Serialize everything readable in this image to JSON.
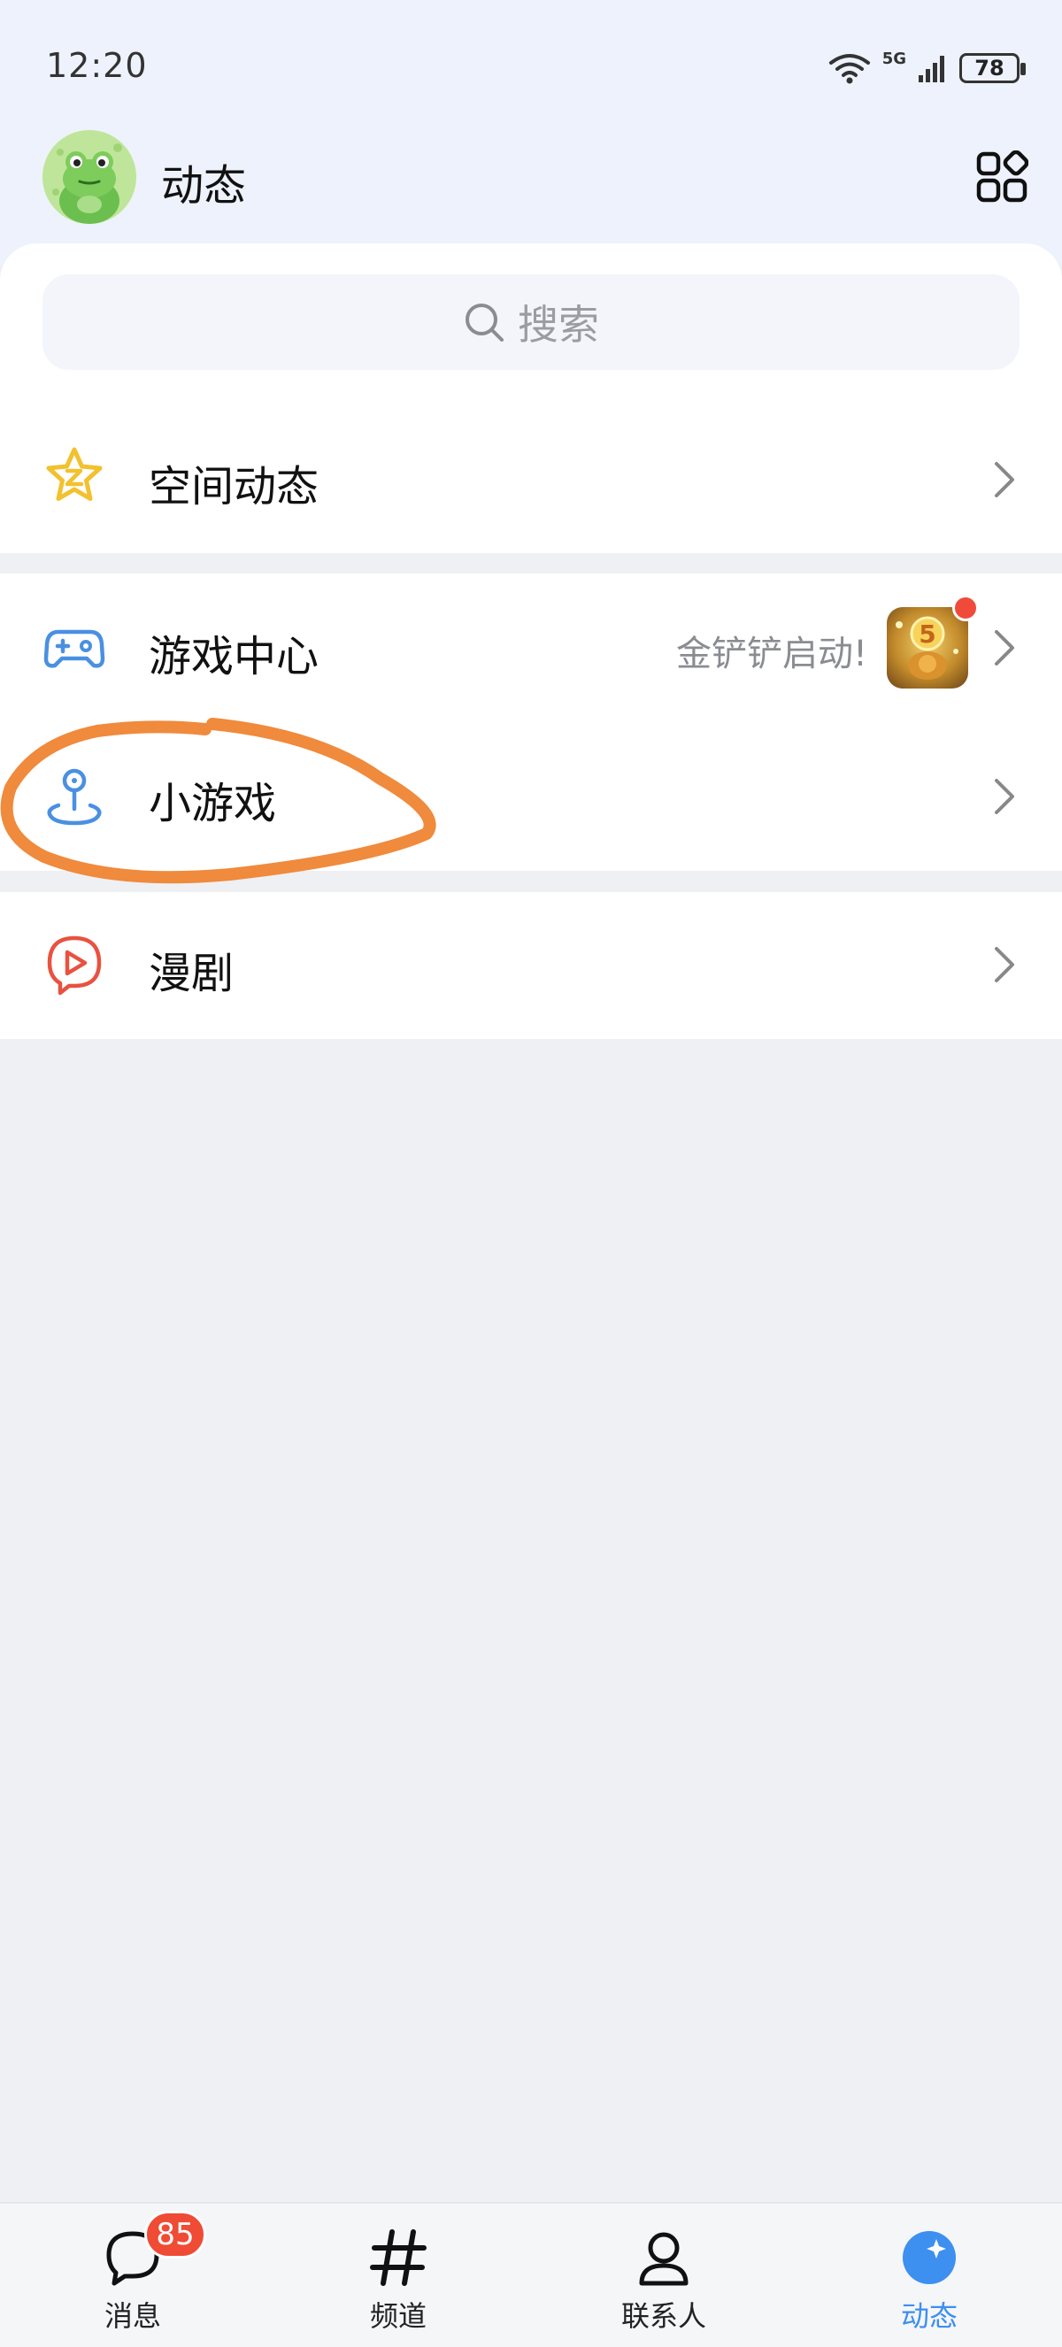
{
  "status_bar": {
    "time": "12:20",
    "network": "5G",
    "battery": "78"
  },
  "header": {
    "title": "动态",
    "avatar_icon": "frog-avatar",
    "apps_icon": "grid-apps-icon"
  },
  "search": {
    "placeholder": "搜索"
  },
  "menu": [
    {
      "label": "空间动态",
      "icon": "star-icon",
      "color": "#f2c12e"
    },
    {
      "label": "游戏中心",
      "icon": "gamepad-icon",
      "color": "#4a90e2",
      "hint": "金铲铲启动!",
      "has_thumbnail": true,
      "has_red_dot": true
    },
    {
      "label": "小游戏",
      "icon": "map-pin-icon",
      "color": "#4a90e2"
    },
    {
      "label": "漫剧",
      "icon": "play-bubble-icon",
      "color": "#e8523f"
    }
  ],
  "tabbar": [
    {
      "label": "消息",
      "icon": "message-icon",
      "badge": "85"
    },
    {
      "label": "频道",
      "icon": "hashtag-icon"
    },
    {
      "label": "联系人",
      "icon": "contacts-icon"
    },
    {
      "label": "动态",
      "icon": "moments-icon",
      "active": true
    }
  ],
  "colors": {
    "accent": "#3d8ff0",
    "annotation": "#f08a3c",
    "badge": "#ef4b35"
  }
}
